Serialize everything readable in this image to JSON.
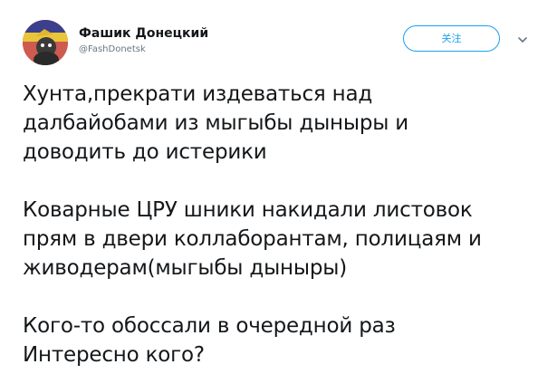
{
  "tweet": {
    "author": {
      "display_name": "Фашик Донецкий",
      "handle": "@FashDonetsk",
      "avatar_icon": "avatar-image"
    },
    "follow_label": "关注",
    "menu_icon": "chevron-down-icon",
    "colors": {
      "accent": "#1da1f2",
      "text": "#14171a",
      "muted": "#657786"
    },
    "paragraphs": [
      {
        "lines": [
          "Хунта,прекрати издеваться над",
          "далбайобами из мыгыбы дыныры и",
          "доводить до истерики"
        ]
      },
      {
        "lines": [
          "Коварные ЦРУ шники накидали листовок",
          "прям в двери коллаборантам, полицаям и",
          "живодерам(мыгыбы дыныры)"
        ]
      },
      {
        "lines": [
          "Кого-то обоссали в очередной раз",
          "Интересно кого?"
        ]
      }
    ]
  }
}
